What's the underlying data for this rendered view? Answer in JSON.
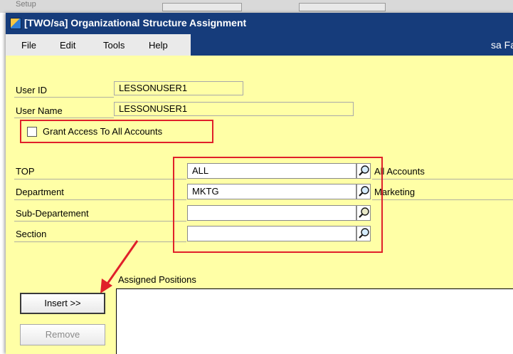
{
  "background": {
    "ghost_text": "Setup"
  },
  "window": {
    "title": "[TWO/sa] Organizational Structure Assignment",
    "menus": [
      "File",
      "Edit",
      "Tools",
      "Help"
    ],
    "user_info": "sa  Fa"
  },
  "user": {
    "id_label": "User ID",
    "id_value": "LESSONUSER1",
    "name_label": "User Name",
    "name_value": "LESSONUSER1",
    "grant_access_label": "Grant Access To All Accounts",
    "grant_access_checked": false
  },
  "structure": {
    "rows": [
      {
        "label": "TOP",
        "value": "ALL",
        "description": "All Accounts"
      },
      {
        "label": "Department",
        "value": "MKTG",
        "description": "Marketing"
      },
      {
        "label": "Sub-Departement",
        "value": "",
        "description": ""
      },
      {
        "label": "Section",
        "value": "",
        "description": ""
      }
    ]
  },
  "positions": {
    "label": "Assigned Positions",
    "insert_label": "Insert >>",
    "remove_label": "Remove"
  },
  "annotation": {
    "color": "#e0202a"
  }
}
